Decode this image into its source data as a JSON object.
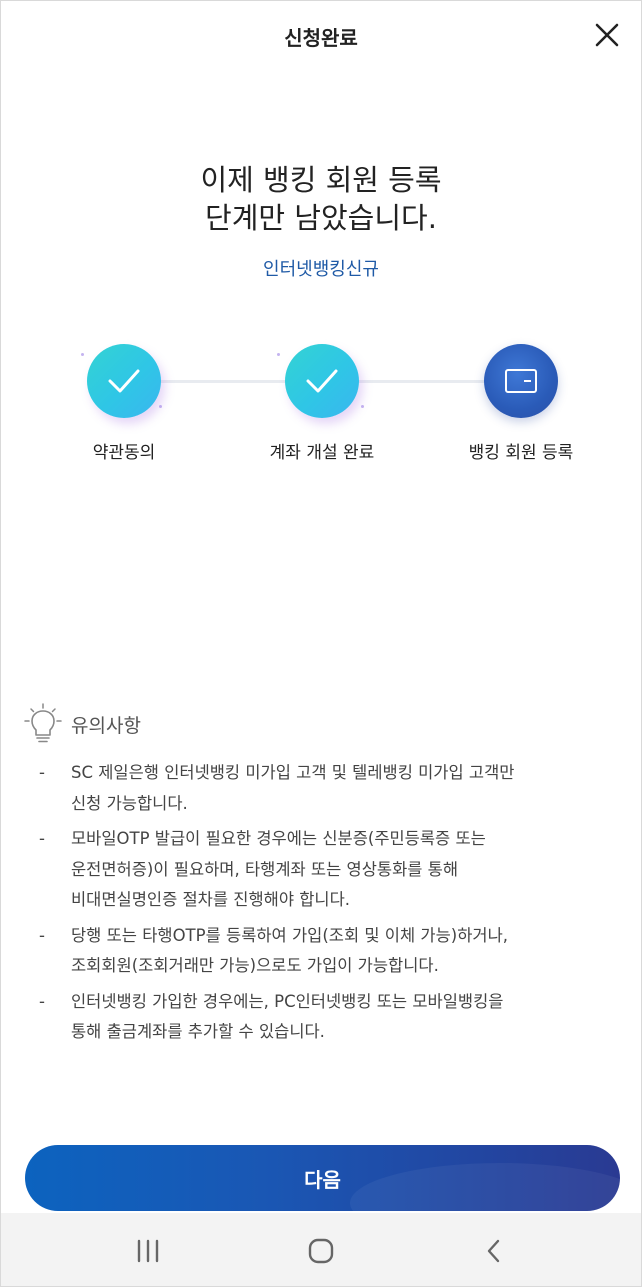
{
  "header": {
    "title": "신청완료"
  },
  "headline": {
    "line1": "이제 뱅킹 회원 등록",
    "line2": "단계만 남았습니다."
  },
  "sub_link": "인터넷뱅킹신규",
  "steps": [
    {
      "label": "약관동의",
      "state": "done"
    },
    {
      "label": "계좌 개설 완료",
      "state": "done"
    },
    {
      "label": "뱅킹 회원 등록",
      "state": "current"
    }
  ],
  "notice": {
    "title": "유의사항",
    "dash": "-",
    "items": [
      {
        "line1": "SC 제일은행 인터넷뱅킹 미가입 고객 및 텔레뱅킹 미가입 고객만",
        "line2": "신청 가능합니다.",
        "line3": ""
      },
      {
        "line1": "모바일OTP 발급이 필요한 경우에는 신분증(주민등록증 또는",
        "line2": "운전면허증)이 필요하며, 타행계좌 또는 영상통화를 통해",
        "line3": "비대면실명인증 절차를 진행해야 합니다."
      },
      {
        "line1": "당행 또는 타행OTP를 등록하여 가입(조회 및 이체 가능)하거나,",
        "line2": "조회회원(조회거래만 가능)으로도 가입이 가능합니다.",
        "line3": ""
      },
      {
        "line1": "인터넷뱅킹 가입한 경우에는, PC인터넷뱅킹 또는 모바일뱅킹을",
        "line2": "통해 출금계좌를 추가할 수 있습니다.",
        "line3": ""
      }
    ]
  },
  "next_button": {
    "label": "다음"
  },
  "colors": {
    "brand_blue": "#1f5aa6",
    "button_start": "#0c63bf",
    "button_end": "#2a3a92",
    "step_done": "#2fc6e6"
  },
  "icons": {
    "close": "close-icon",
    "check": "check-icon",
    "card": "card-icon",
    "bulb": "lightbulb-icon",
    "recents": "recents-icon",
    "home": "home-icon",
    "back": "back-icon"
  }
}
